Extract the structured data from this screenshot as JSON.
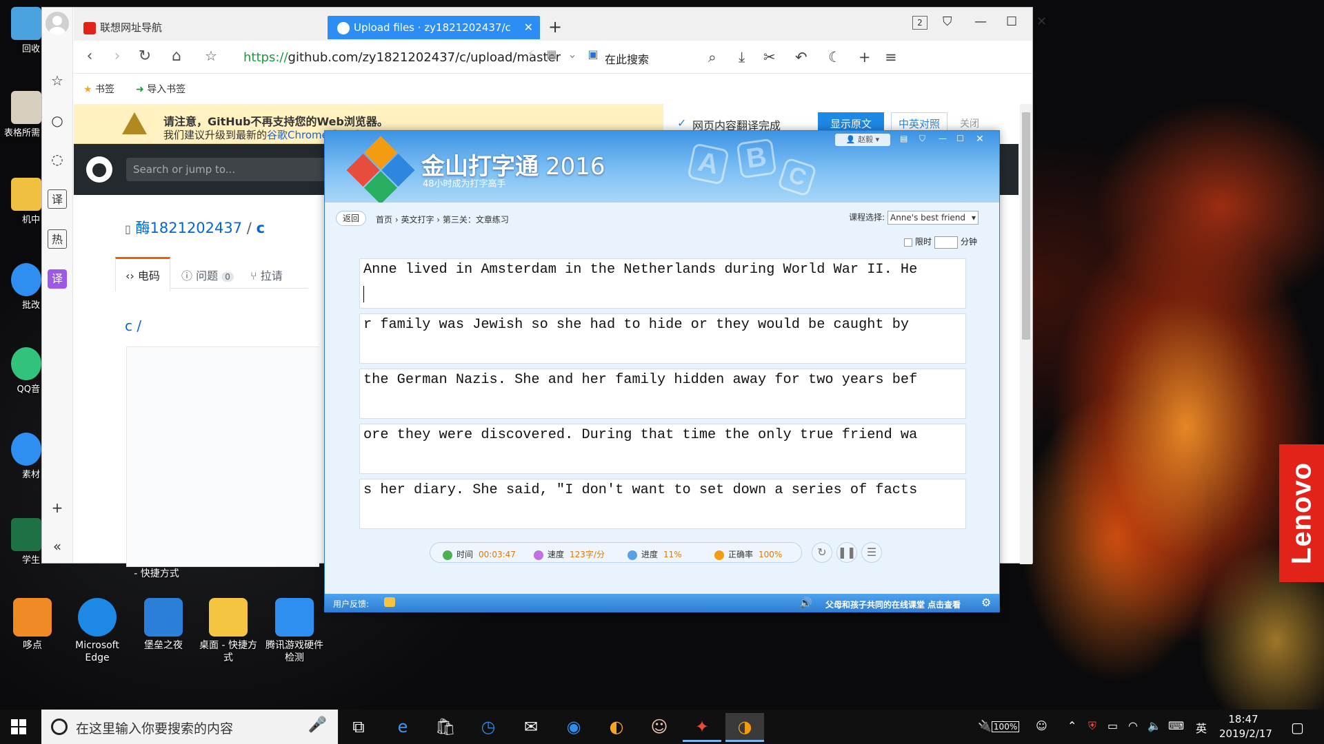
{
  "desktop": {
    "icons_left": [
      {
        "label": "回收",
        "color": "#4aa3df"
      },
      {
        "label": "表格所需",
        "color": "#d8cfc0"
      },
      {
        "label": "机中",
        "color": "#f0c040"
      },
      {
        "label": "批改",
        "color": "#2e8ff0"
      },
      {
        "label": "QQ音",
        "color": "#31c27c"
      },
      {
        "label": "素材",
        "color": "#2e8ff0"
      },
      {
        "label": "学生",
        "color": "#1e7145"
      }
    ],
    "icons_bottom": [
      {
        "label": "哆点",
        "color": "#f08a24"
      },
      {
        "label": "Microsoft Edge",
        "color": "#1e88e5"
      },
      {
        "label": "堡垒之夜",
        "color": "#2b7fd8"
      },
      {
        "label": "桌面 - 快捷方式",
        "color": "#f5c542"
      },
      {
        "label": "腾讯游戏硬件检测",
        "color": "#2e8ff0"
      }
    ],
    "partial_labels": [
      "- 快捷方式"
    ],
    "brand": "Lenovo"
  },
  "browser": {
    "tabs": [
      {
        "label": "联想网址导航",
        "icon": "lenovo-l-icon",
        "active": false
      },
      {
        "label": "Upload files · zy1821202437/c",
        "icon": "github-icon",
        "active": true
      }
    ],
    "tab_count_badge": "2",
    "url_scheme": "https://",
    "url_rest": "github.com/zy1821202437/c/upload/master",
    "search_placeholder": "在此搜索",
    "bookmarks": {
      "label": "书签",
      "import_label": "导入书签"
    },
    "banner": {
      "line1": "请注意，GitHub不再支持您的Web浏览器。",
      "line2_prefix": "我们建议升级到最新的",
      "line2_link": "谷歌Chrome或火狐"
    },
    "translate": {
      "done": "网页内容翻译完成",
      "show_original": "显示原文",
      "bilingual": "中英对照",
      "close": "关闭"
    },
    "github": {
      "search_placeholder": "Search or jump to...",
      "owner": "酶1821202437",
      "separator": "/",
      "repo": "c",
      "tabs": [
        {
          "label": "电码",
          "icon": "code-icon"
        },
        {
          "label": "问题",
          "count": "0"
        },
        {
          "label": "拉请",
          "icon": "pull-request-icon"
        }
      ],
      "path": "c /"
    }
  },
  "typing_app": {
    "title": "金山打字通",
    "year": "2016",
    "subtitle": "48小时成为打字高手",
    "user": "赵毅",
    "back": "返回",
    "breadcrumb": [
      "首页",
      "英文打字",
      "第三关：文章练习"
    ],
    "course_label": "课程选择:",
    "course_value": "Anne's best friend",
    "limit_label": "限时",
    "minutes_label": "分钟",
    "lines": [
      "Anne lived in Amsterdam in the Netherlands during World War II. He",
      "r family was Jewish so she had to hide or they would be caught by",
      "the German Nazis. She and her family hidden away for two years bef",
      "ore they were discovered. During that time the only true friend wa",
      "s her diary. She said, \"I don't want to set down a series of facts"
    ],
    "stats": {
      "time_label": "时间",
      "time_value": "00:03:47",
      "speed_label": "速度",
      "speed_value": "123字/分",
      "progress_label": "进度",
      "progress_value": "11%",
      "accuracy_label": "正确率",
      "accuracy_value": "100%"
    },
    "footer": {
      "feedback": "用户反馈:",
      "promo": "父母和孩子共同的在线课堂 点击查看"
    }
  },
  "taskbar": {
    "search_placeholder": "在这里输入你要搜索的内容",
    "battery": "100%",
    "ime": "英",
    "time": "18:47",
    "date": "2019/2/17"
  }
}
